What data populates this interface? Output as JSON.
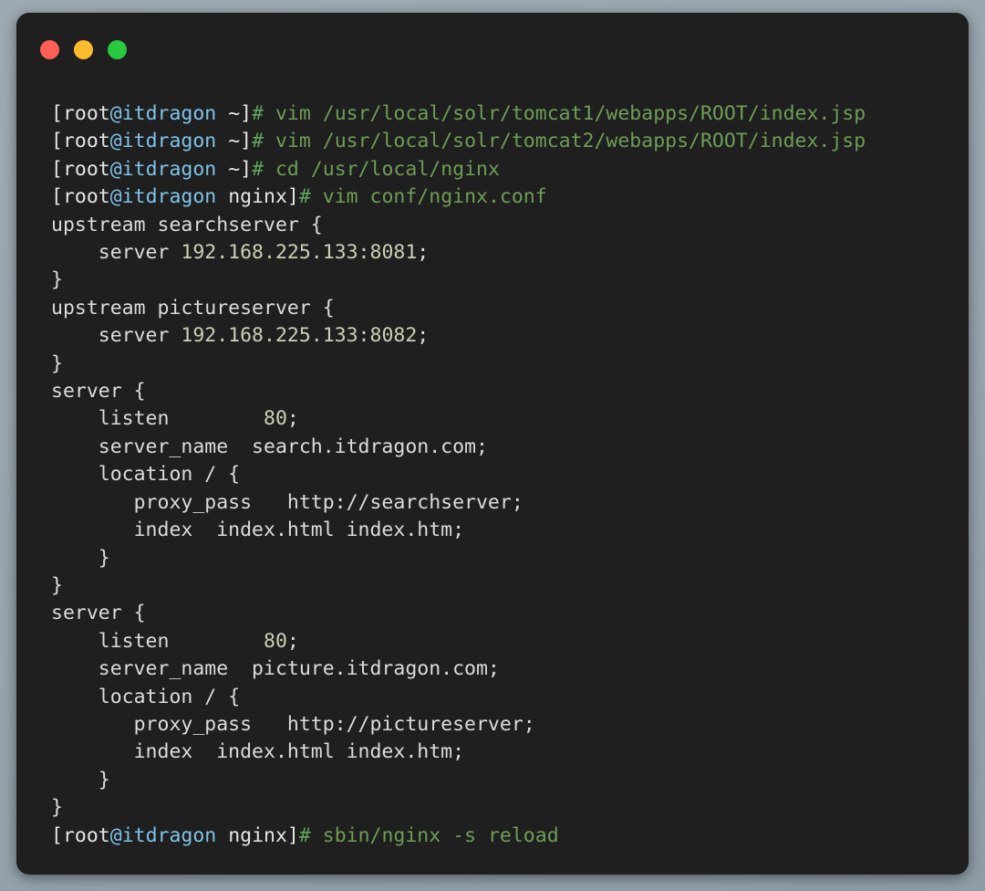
{
  "window": {
    "title": "",
    "controls": [
      {
        "name": "close",
        "color": "#FF5F57"
      },
      {
        "name": "minimize",
        "color": "#FDBC2E"
      },
      {
        "name": "maximize",
        "color": "#28C840"
      }
    ],
    "background": "#1F1F1F",
    "desktop_background": "#98A5AE"
  },
  "theme": {
    "foreground": "#D8D8D8",
    "host_color": "#7FC3E8",
    "command_color": "#6D9E55",
    "value_color": "#C8D3B4",
    "prompt_hash_color": "#5FA45F"
  },
  "prompts": {
    "home": {
      "open_bracket": "[",
      "user": "root",
      "at": "@",
      "host": "itdragon",
      "space_cwd": " ~]",
      "hash": "# "
    },
    "nginx": {
      "open_bracket": "[",
      "user": "root",
      "at": "@",
      "host": "itdragon",
      "space_cwd": " nginx]",
      "hash": "# "
    }
  },
  "terminal": {
    "lines": [
      {
        "type": "prompt",
        "prompt": "home",
        "command": "vim /usr/local/solr/tomcat1/webapps/ROOT/index.jsp"
      },
      {
        "type": "prompt",
        "prompt": "home",
        "command": "vim /usr/local/solr/tomcat2/webapps/ROOT/index.jsp"
      },
      {
        "type": "prompt",
        "prompt": "home",
        "command": "cd /usr/local/nginx"
      },
      {
        "type": "prompt",
        "prompt": "nginx",
        "command": "vim conf/nginx.conf"
      },
      {
        "type": "output",
        "plain": "upstream searchserver {"
      },
      {
        "type": "output",
        "plain": "    server ",
        "value": "192.168.225.133:8081",
        "tail": ";"
      },
      {
        "type": "output",
        "plain": "}"
      },
      {
        "type": "output",
        "plain": "upstream pictureserver {"
      },
      {
        "type": "output",
        "plain": "    server ",
        "value": "192.168.225.133:8082",
        "tail": ";"
      },
      {
        "type": "output",
        "plain": "}"
      },
      {
        "type": "output",
        "plain": "server {"
      },
      {
        "type": "output",
        "plain": "    listen        ",
        "value": "80",
        "tail": ";"
      },
      {
        "type": "output",
        "plain": "    server_name  search.itdragon.com;"
      },
      {
        "type": "output",
        "plain": "    location / {"
      },
      {
        "type": "output",
        "plain": "       proxy_pass   http://searchserver;"
      },
      {
        "type": "output",
        "plain": "       index  index.html index.htm;"
      },
      {
        "type": "output",
        "plain": "    }"
      },
      {
        "type": "output",
        "plain": "}"
      },
      {
        "type": "output",
        "plain": "server {"
      },
      {
        "type": "output",
        "plain": "    listen        ",
        "value": "80",
        "tail": ";"
      },
      {
        "type": "output",
        "plain": "    server_name  picture.itdragon.com;"
      },
      {
        "type": "output",
        "plain": "    location / {"
      },
      {
        "type": "output",
        "plain": "       proxy_pass   http://pictureserver;"
      },
      {
        "type": "output",
        "plain": "       index  index.html index.htm;"
      },
      {
        "type": "output",
        "plain": "    }"
      },
      {
        "type": "output",
        "plain": "}"
      },
      {
        "type": "prompt",
        "prompt": "nginx",
        "command": "sbin/nginx -s reload"
      }
    ]
  }
}
